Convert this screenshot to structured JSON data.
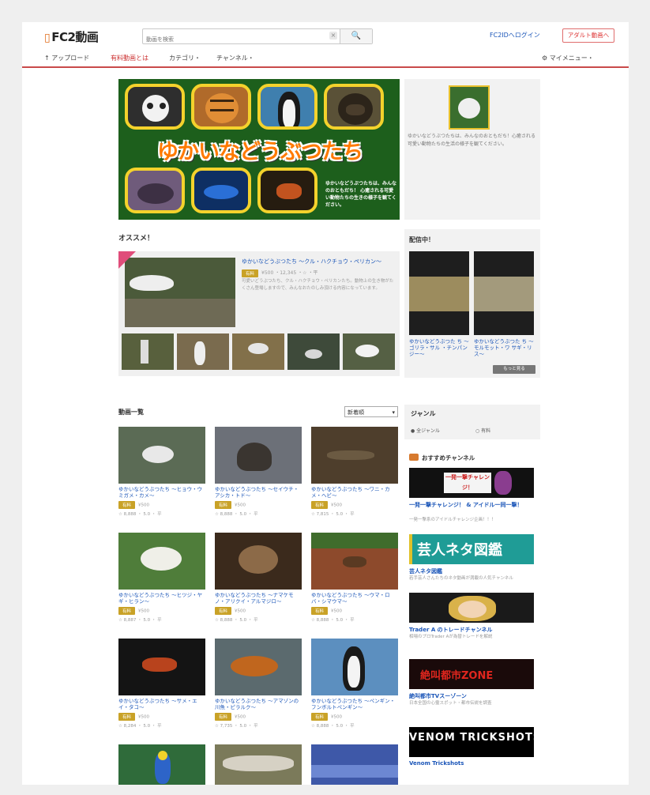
{
  "header": {
    "logo": "FC2動画",
    "search_placeholder": "動画を検索",
    "clear_label": "×",
    "search_btn": "🔍",
    "login": "FC2IDへログイン",
    "adult": "アダルト動画へ"
  },
  "nav": {
    "upload": "↑ アップロード",
    "paid": "有料動画とは",
    "category": "カテゴリ・",
    "channel": "チャンネル・",
    "mymenu": "⚙ マイメニュー・"
  },
  "banner": {
    "title": "ゆかいなどうぶつたち",
    "copy": "ゆかいなどうぶつたちは、みんなのおともだち！ 心癒される可愛い動物たちの生きの様子を観てください。"
  },
  "banner_info": {
    "text": "ゆかいなどうぶつたちは、みんなのおともだち！心癒される可愛い動物たちの生活の様子を観てください。"
  },
  "recommend": {
    "title": "オススメ！",
    "video_title": "ゆかいなどうぶつたち 〜クル・ハクチョウ・ペリカン〜",
    "badge": "有料",
    "meta": "¥500 ・12,345 ・☆ ・平",
    "desc": "可愛いどうぶつたち、クル・ハクチョウ・ペリカンたち。動物上の生き物がたくさん登場しますので、みんなおたのしみ頂ける内容になっています。"
  },
  "now_playing": {
    "title": "配信中！",
    "items": [
      {
        "label": "ゆかいなどうぶつた ち 〜ゴリラ・サル ・チンパンジー〜"
      },
      {
        "label": "ゆかいなどうぶつた ち 〜モルモット・ワ サギ・リス〜"
      }
    ],
    "more": "もっと見る"
  },
  "list": {
    "title": "動画一覧",
    "sort": "新着順"
  },
  "videos": [
    {
      "title": "ゆかいなどうぶつたち 〜ヒョウ・ウミガメ・カメ〜",
      "badge": "有料",
      "price": "¥500",
      "stats": "☆ 8,888 ・ 5.0 ・ 平"
    },
    {
      "title": "ゆかいなどうぶつたち 〜セイウチ・アシカ・トド〜",
      "badge": "有料",
      "price": "¥500",
      "stats": "☆ 8,888 ・ 5.0 ・ 平"
    },
    {
      "title": "ゆかいなどうぶつたち 〜ワニ・カメ・ヘビ〜",
      "badge": "有料",
      "price": "¥500",
      "stats": "☆ 7,815 ・ 5.0 ・ 平"
    },
    {
      "title": "ゆかいなどうぶつたち 〜ヒツジ・ヤギ・ヒラン〜",
      "badge": "有料",
      "price": "¥500",
      "stats": "☆ 8,887 ・ 5.0 ・ 平"
    },
    {
      "title": "ゆかいなどうぶつたち 〜ナマケモノ・アリクイ・アルマジロ〜",
      "badge": "有料",
      "price": "¥500",
      "stats": "☆ 8,888 ・ 5.0 ・ 平"
    },
    {
      "title": "ゆかいなどうぶつたち 〜ウマ・ロバ・シマウマ〜",
      "badge": "有料",
      "price": "¥500",
      "stats": "☆ 8,888 ・ 5.0 ・ 平"
    },
    {
      "title": "ゆかいなどうぶつたち 〜サメ・エイ・タコ〜",
      "badge": "有料",
      "price": "¥500",
      "stats": "☆ 8,284 ・ 5.0 ・ 平"
    },
    {
      "title": "ゆかいなどうぶつたち 〜アマゾンの川魚・ピラルク〜",
      "badge": "有料",
      "price": "¥500",
      "stats": "☆ 7,735 ・ 5.0 ・ 平"
    },
    {
      "title": "ゆかいなどうぶつたち 〜ペンギン・フンボルトペンギン〜",
      "badge": "有料",
      "price": "¥500",
      "stats": "☆ 8,888 ・ 5.0 ・ 平"
    }
  ],
  "genre": {
    "title": "ジャンル",
    "opt1": "● 全ジャンル",
    "opt2": "○ 有料"
  },
  "channels": {
    "title": "おすすめチャンネル",
    "items": [
      {
        "banner": "一発一撃チャレンジ！",
        "name": "一発一撃チャレンジ！ & アイドル一同一撃！",
        "desc": "一発一撃系のアイドルチャレンジ企画！！！"
      },
      {
        "banner": "芸人ネタ図鑑",
        "name": "芸人ネタ図鑑",
        "desc": "若手芸人さんたちのネタ動画が満載の人気チャンネル"
      },
      {
        "banner": "",
        "name": "Trader A のトレードチャンネル",
        "desc": "相場のプロTrader Aが為替トレードを解説"
      },
      {
        "banner": "絶叫都市ZONE",
        "name": "絶叫都市TVスーゾーン",
        "desc": "日本全国の心霊スポット・都市伝説を調査"
      },
      {
        "banner": "VENOM TRICKSHOTS",
        "name": "Venom Trickshots",
        "desc": ""
      }
    ]
  },
  "colors": {
    "accent_red": "#c94a4a",
    "link_blue": "#1a55b8",
    "badge_gold": "#c9a227"
  }
}
